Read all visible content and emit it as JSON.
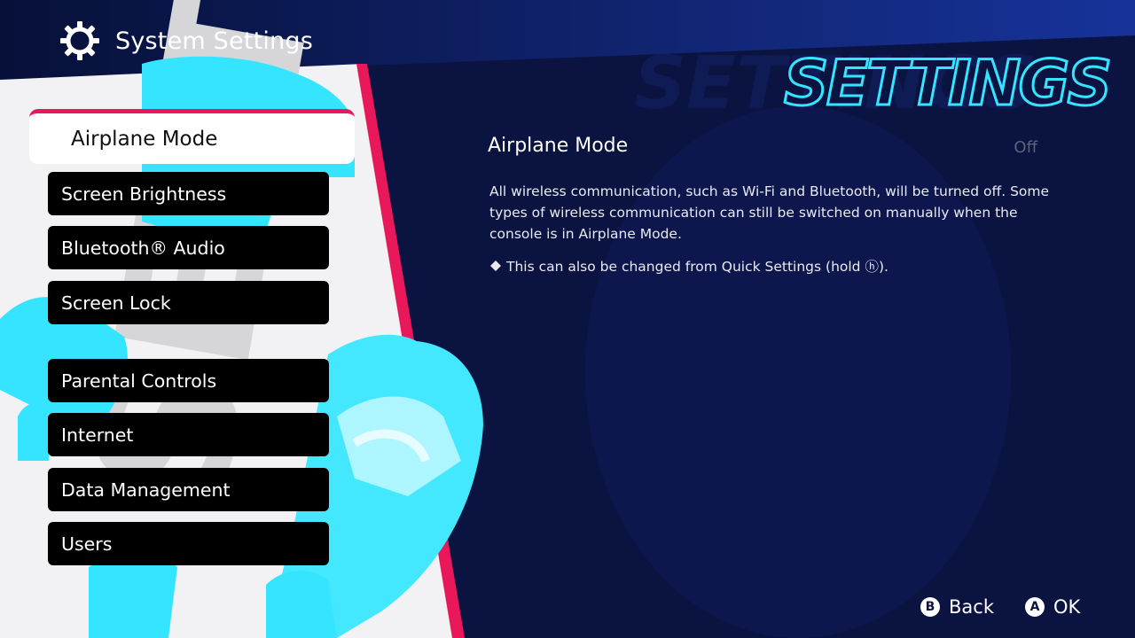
{
  "header": {
    "title": "System Settings",
    "icon": "gear-icon"
  },
  "brand": {
    "logo_text": "SETTINGS"
  },
  "colors": {
    "accent": "#e8185a",
    "cyan": "#35e4ff",
    "background": "#0b1340",
    "menu_item_bg": "#000000",
    "selected_bg": "#ffffff"
  },
  "menu": {
    "selected": {
      "label": "Airplane Mode"
    },
    "items": [
      {
        "label": "Screen Brightness"
      },
      {
        "label": "Bluetooth® Audio"
      },
      {
        "label": "Screen Lock"
      },
      {
        "label": "Parental Controls"
      },
      {
        "label": "Internet"
      },
      {
        "label": "Data Management"
      },
      {
        "label": "Users"
      }
    ]
  },
  "detail": {
    "title": "Airplane Mode",
    "value": "Off",
    "description": "All wireless communication, such as Wi-Fi and Bluetooth, will be turned off. Some types of wireless communication can still be switched on manually when the console is in Airplane Mode.",
    "note": "This can also be changed from Quick Settings (hold ⓗ).",
    "note_icon": "diamond-icon"
  },
  "footer": {
    "back": {
      "glyph": "B",
      "label": "Back"
    },
    "ok": {
      "glyph": "A",
      "label": "OK"
    }
  }
}
